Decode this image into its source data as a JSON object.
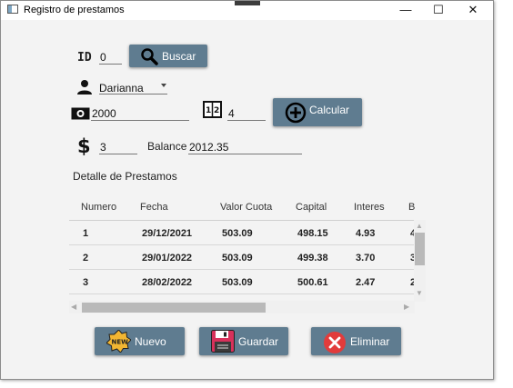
{
  "window": {
    "title": "Registro de prestamos",
    "minimize": "—",
    "maximize": "☐",
    "close": "✕"
  },
  "form": {
    "id_label": "ID",
    "id_value": "0",
    "buscar_label": "Buscar",
    "persona_value": "Darianna",
    "monto_value": "2000",
    "cuotas_value": "4",
    "calcular_label": "Calcular",
    "interes_value": "3",
    "balance_label": "Balance",
    "balance_value": "2012.35"
  },
  "detalle": {
    "title": "Detalle de Prestamos",
    "columns": [
      "Numero",
      "Fecha",
      "Valor Cuota",
      "Capital",
      "Interes",
      "B"
    ],
    "rows": [
      [
        "1",
        "29/12/2021",
        "503.09",
        "498.15",
        "4.93",
        "4"
      ],
      [
        "2",
        "29/01/2022",
        "503.09",
        "499.38",
        "3.70",
        "3"
      ],
      [
        "3",
        "28/02/2022",
        "503.09",
        "500.61",
        "2.47",
        "2"
      ]
    ]
  },
  "actions": {
    "nuevo_label": "Nuevo",
    "guardar_label": "Guardar",
    "eliminar_label": "Eliminar"
  },
  "icons": {
    "app": "window-icon",
    "id": "id-icon",
    "buscar": "magnifier-icon",
    "persona": "person-icon",
    "monto": "money-icon",
    "cuotas": "calendar-icon",
    "calcular": "plus-circle-icon",
    "interes": "dollar-icon",
    "nuevo": "new-badge-icon",
    "guardar": "floppy-disk-icon",
    "eliminar": "delete-x-icon"
  },
  "colors": {
    "button": "#5f7c90",
    "background": "#f3f3f3",
    "delete": "#e23b3b",
    "new_badge": "#f2b632",
    "floppy": "#d8315b"
  }
}
